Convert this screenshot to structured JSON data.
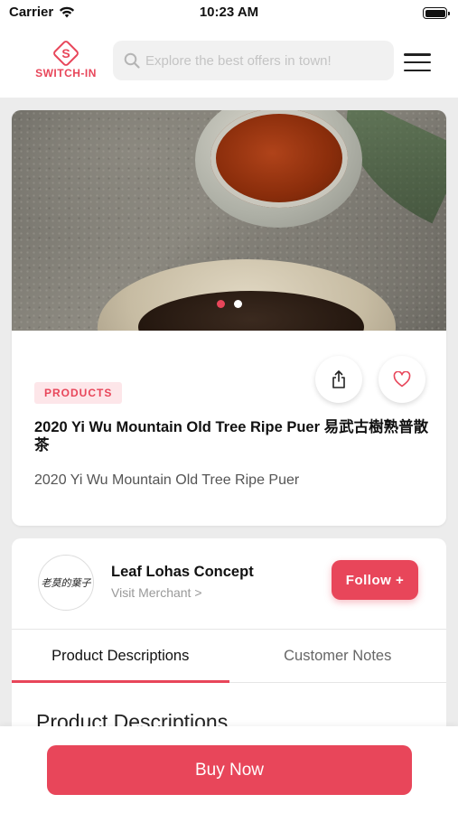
{
  "status_bar": {
    "carrier": "Carrier",
    "time": "10:23 AM"
  },
  "header": {
    "logo_mark": "S",
    "logo_text": "SWITCH-IN",
    "search_placeholder": "Explore the best offers in town!"
  },
  "product": {
    "badge": "PRODUCTS",
    "title": "2020 Yi Wu Mountain Old Tree Ripe Puer 易武古樹熟普散茶",
    "subtitle": "2020 Yi Wu Mountain Old Tree Ripe Puer",
    "carousel_total": 2,
    "carousel_active": 1
  },
  "merchant": {
    "avatar_text": "老莫的葉子",
    "name": "Leaf Lohas Concept",
    "link": "Visit Merchant >",
    "follow_label": "Follow +"
  },
  "tabs": [
    {
      "label": "Product Descriptions",
      "active": true
    },
    {
      "label": "Customer Notes",
      "active": false
    }
  ],
  "section_heading": "Product Descriptions",
  "bottom": {
    "buy_label": "Buy Now"
  },
  "colors": {
    "accent": "#e8465a",
    "badge_bg": "#fde6e9"
  }
}
